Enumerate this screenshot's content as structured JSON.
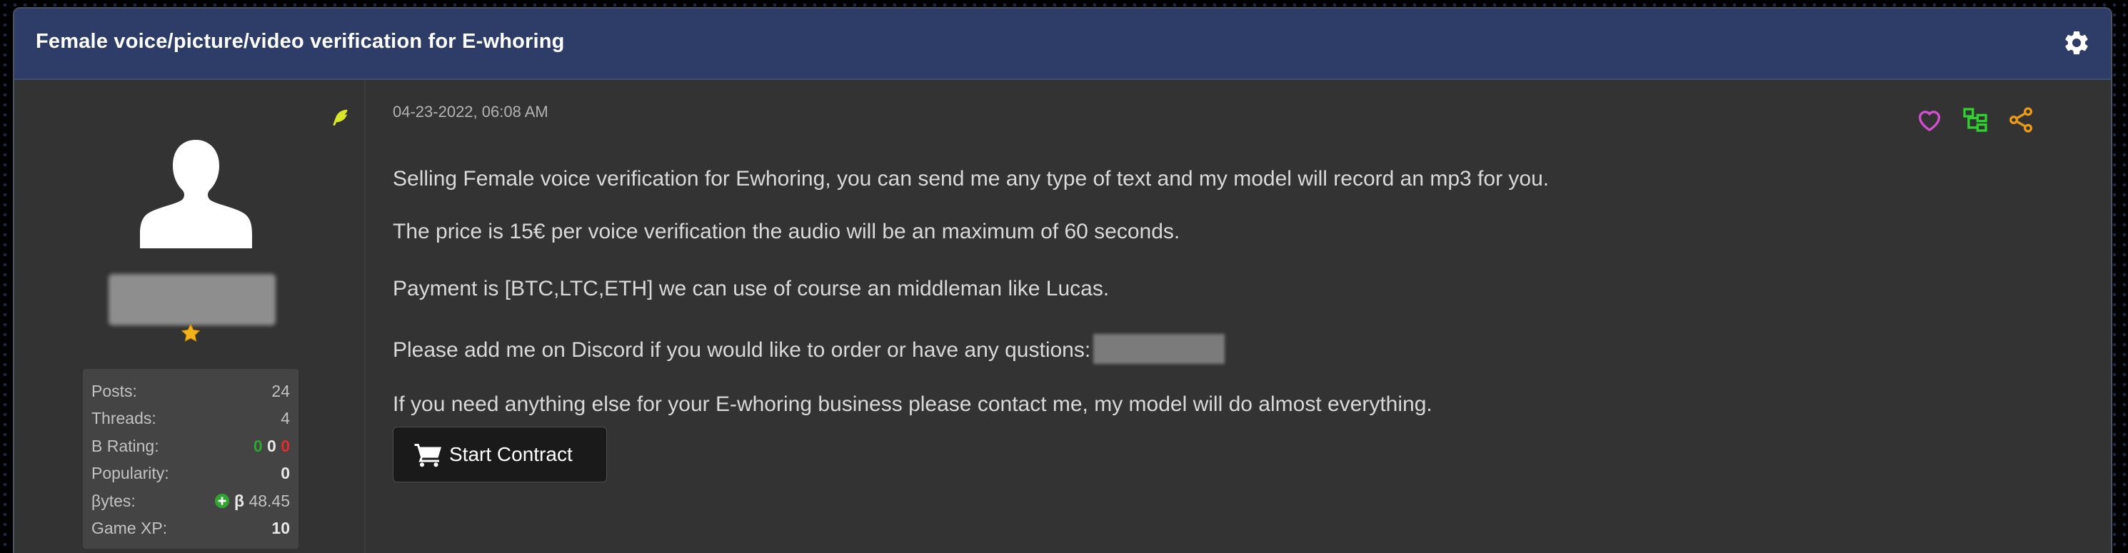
{
  "thread": {
    "title": "Female voice/picture/video verification for E-whoring",
    "settings_icon": "gear-icon"
  },
  "author": {
    "rank_icon": "feather-icon",
    "avatar": "default-user-silhouette",
    "username": "[blurred]",
    "star_icon": "star-icon",
    "stats": [
      {
        "label": "Posts:",
        "value": "24"
      },
      {
        "label": "Threads:",
        "value": "4"
      },
      {
        "label": "B Rating:",
        "positive": "0",
        "neutral": "0",
        "negative": "0"
      },
      {
        "label": "Popularity:",
        "value": "0"
      },
      {
        "label": "βytes:",
        "symbol": "β",
        "value": "48.45"
      },
      {
        "label": "Game XP:",
        "value": "10"
      }
    ]
  },
  "post": {
    "date": "04-23-2022, 06:08 AM",
    "paragraphs": [
      "Selling Female voice verification for Ewhoring, you can send me any type of text and my model will record an mp3 for you.",
      "The price is 15€ per voice verification the audio will be an maximum of 60 seconds.",
      "Payment is [BTC,LTC,ETH] we can use of course an middleman like Lucas.",
      "Please add me on Discord if you would like to order or have any qustions:",
      "If you need anything else for your E-whoring business please contact me, my model will do almost everything."
    ],
    "contract_button": "Start Contract",
    "actions": [
      "heart-icon",
      "tree-icon",
      "share-icon"
    ]
  },
  "colors": {
    "header_bg": "#2e3d67",
    "panel_bg": "#333333",
    "heart": "#d14fd1",
    "tree": "#2fd12f",
    "share": "#e89a18",
    "rating_positive": "#2fa52f",
    "rating_negative": "#e02e2e"
  }
}
